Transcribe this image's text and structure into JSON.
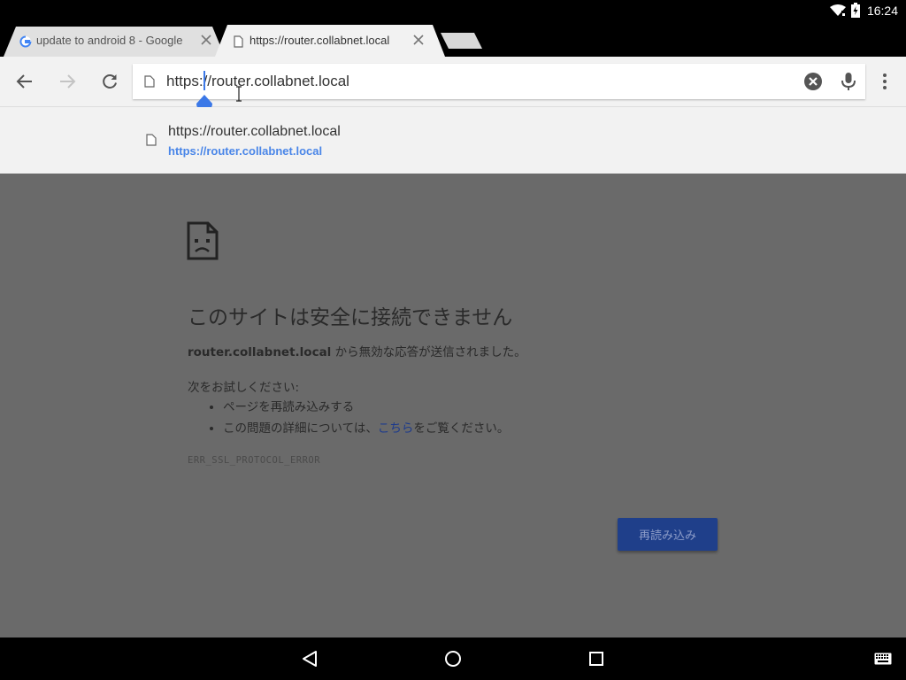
{
  "status_bar": {
    "time": "16:24",
    "icons": [
      "wifi-icon",
      "battery-icon"
    ]
  },
  "tabs": [
    {
      "title": "update to android 8 - Google",
      "favicon": "google-g-icon",
      "active": false
    },
    {
      "title": "https://router.collabnet.local",
      "favicon": "page-icon",
      "active": true
    }
  ],
  "toolbar": {
    "url_value": "https://router.collabnet.local",
    "icons": [
      "back-arrow-icon",
      "forward-arrow-icon",
      "reload-icon",
      "clear-icon",
      "mic-icon",
      "overflow-menu-icon"
    ]
  },
  "suggestion": {
    "title": "https://router.collabnet.local",
    "url": "https://router.collabnet.local"
  },
  "error_page": {
    "heading": "このサイトは安全に接続できません",
    "host": "router.collabnet.local",
    "description_suffix": " から無効な応答が送信されました。",
    "try_label": "次をお試しください:",
    "item1": "ページを再読み込みする",
    "item2_prefix": "この問題の詳細については、",
    "item2_link": "こちら",
    "item2_suffix": "をご覧ください。",
    "error_code": "ERR_SSL_PROTOCOL_ERROR",
    "reload_button": "再読み込み"
  },
  "colors": {
    "accent": "#4a86e8",
    "overlay": "#6a6a6a",
    "button": "#1f3f8a"
  }
}
